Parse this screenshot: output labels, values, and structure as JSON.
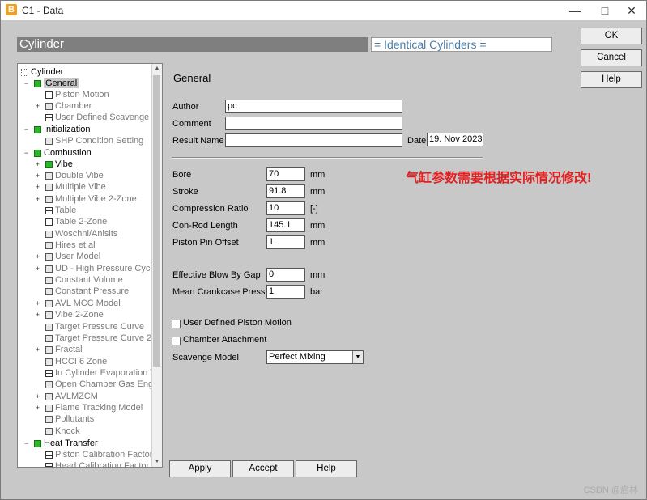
{
  "window": {
    "title": "C1 - Data",
    "app_icon": "B"
  },
  "header": {
    "title": "Cylinder",
    "identical": "= Identical Cylinders ="
  },
  "side_buttons": {
    "ok": "OK",
    "cancel": "Cancel",
    "help": "Help"
  },
  "tree": {
    "items": [
      {
        "label": "Cylinder"
      },
      {
        "label": "General"
      },
      {
        "label": "Piston Motion"
      },
      {
        "label": "Chamber"
      },
      {
        "label": "User Defined Scavenge I"
      },
      {
        "label": "Initialization"
      },
      {
        "label": "SHP Condition Setting"
      },
      {
        "label": "Combustion"
      },
      {
        "label": "Vibe"
      },
      {
        "label": "Double Vibe"
      },
      {
        "label": "Multiple Vibe"
      },
      {
        "label": "Multiple Vibe 2-Zone"
      },
      {
        "label": "Table"
      },
      {
        "label": "Table 2-Zone"
      },
      {
        "label": "Woschni/Anisits"
      },
      {
        "label": "Hires et al"
      },
      {
        "label": "User Model"
      },
      {
        "label": "UD - High Pressure Cycle"
      },
      {
        "label": "Constant Volume"
      },
      {
        "label": "Constant Pressure"
      },
      {
        "label": "AVL MCC Model"
      },
      {
        "label": "Vibe 2-Zone"
      },
      {
        "label": "Target Pressure Curve"
      },
      {
        "label": "Target Pressure Curve 2"
      },
      {
        "label": "Fractal"
      },
      {
        "label": "HCCI 6 Zone"
      },
      {
        "label": "In Cylinder Evaporation T"
      },
      {
        "label": "Open Chamber Gas Eng"
      },
      {
        "label": "AVLMZCM"
      },
      {
        "label": "Flame Tracking Model"
      },
      {
        "label": "Pollutants"
      },
      {
        "label": "Knock"
      },
      {
        "label": "Heat Transfer"
      },
      {
        "label": "Piston Calibration Factor"
      },
      {
        "label": "Head Calibration Factor"
      }
    ]
  },
  "panel": {
    "title": "General",
    "author_label": "Author",
    "author_value": "pc",
    "comment_label": "Comment",
    "comment_value": "",
    "result_label": "Result Name",
    "result_value": "",
    "date_label": "Date",
    "date_value": "19. Nov 2023",
    "bore_label": "Bore",
    "bore_value": "70",
    "bore_unit": "mm",
    "stroke_label": "Stroke",
    "stroke_value": "91.8",
    "stroke_unit": "mm",
    "cr_label": "Compression Ratio",
    "cr_value": "10",
    "cr_unit": "[-]",
    "conrod_label": "Con-Rod Length",
    "conrod_value": "145.1",
    "conrod_unit": "mm",
    "pin_label": "Piston Pin Offset",
    "pin_value": "1",
    "pin_unit": "mm",
    "blowby_label": "Effective Blow By Gap",
    "blowby_value": "0",
    "blowby_unit": "mm",
    "crankcase_label": "Mean Crankcase Press.",
    "crankcase_value": "1",
    "crankcase_unit": "bar",
    "udpm_label": "User Defined Piston Motion",
    "chamber_label": "Chamber Attachment",
    "scavenge_label": "Scavenge Model",
    "scavenge_value": "Perfect Mixing",
    "note": "气缸参数需要根据实际情况修改!"
  },
  "bottom_buttons": {
    "apply": "Apply",
    "accept": "Accept",
    "help": "Help"
  },
  "watermark": "CSDN @启林"
}
